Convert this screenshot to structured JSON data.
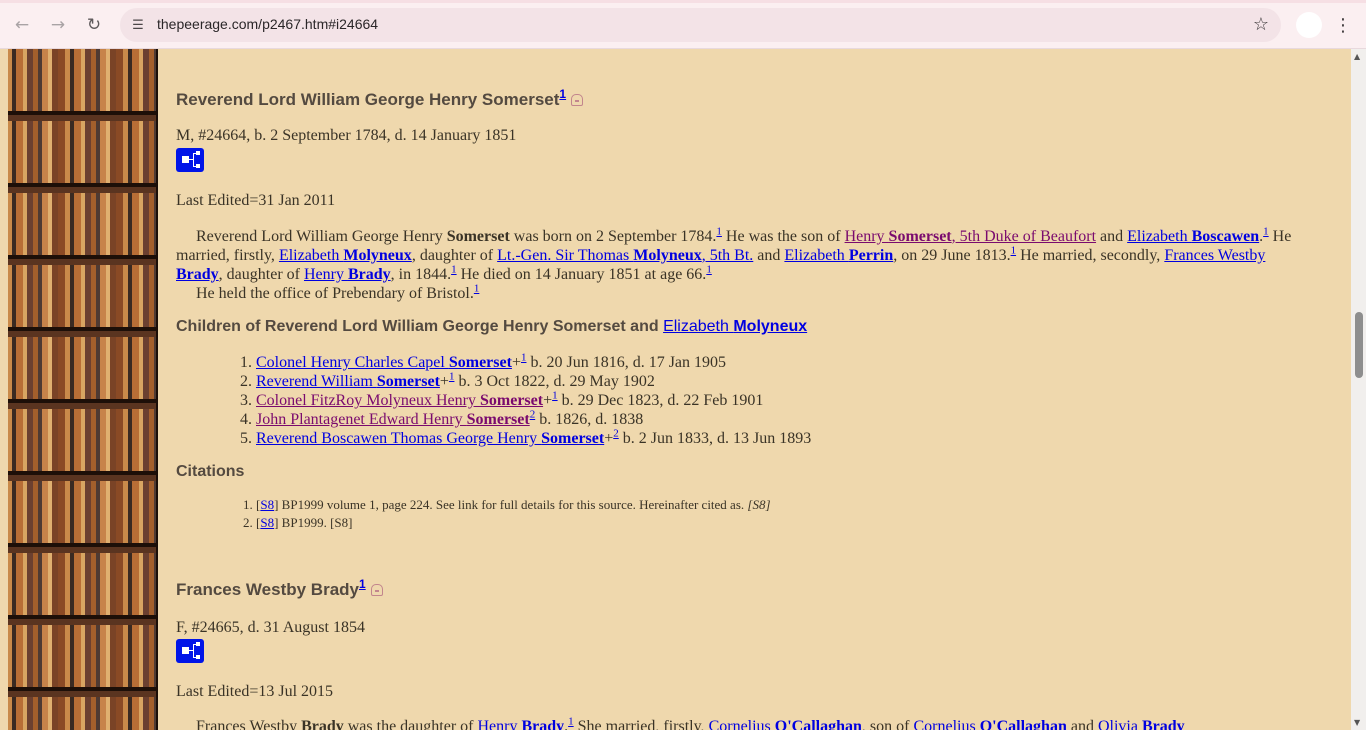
{
  "browser": {
    "url": "thepeerage.com/p2467.htm#i24664"
  },
  "person1": {
    "title_name": "Reverend Lord William George Henry Somerset",
    "title_sup": "1",
    "meta": "M, #24664, b. 2 September 1784, d. 14 January 1851",
    "last_edited": "Last Edited=31 Jan 2011",
    "bio": {
      "a": "Reverend Lord William George Henry ",
      "a_bold": "Somerset",
      "b": " was born on 2 September 1784.",
      "s1": "1",
      "c": " He was the son of ",
      "father_a": "Henry ",
      "father_bold": "Somerset",
      "father_b": ", 5th Duke of Beaufort",
      "d": " and ",
      "mother_a": "Elizabeth ",
      "mother_bold": "Boscawen",
      "e": ".",
      "s2": "1",
      "f": " He married, firstly, ",
      "wife1_a": "Elizabeth ",
      "wife1_bold": "Molyneux",
      "g": ", daughter of ",
      "wf1_a": "Lt.-Gen. Sir Thomas ",
      "wf1_bold": "Molyneux",
      "wf1_b": ", 5th Bt.",
      "h": " and ",
      "wm1_a": "Elizabeth ",
      "wm1_bold": "Perrin",
      "i": ", on 29 June 1813.",
      "s3": "1",
      "j": " He married, secondly, ",
      "wife2_a": "Frances Westby ",
      "wife2_bold": "Brady",
      "k": ", daughter of ",
      "wf2_a": "Henry ",
      "wf2_bold": "Brady",
      "l": ", in 1844.",
      "s4": "1",
      "m": " He died on 14 January 1851 at age 66.",
      "s5": "1",
      "office": "He held the office of Prebendary of Bristol.",
      "s6": "1"
    },
    "children_heading": "Children of Reverend Lord William George Henry Somerset and ",
    "children_heading_link_a": "Elizabeth ",
    "children_heading_link_bold": "Molyneux",
    "children": [
      {
        "name_a": "Colonel Henry Charles Capel ",
        "name_bold": "Somerset",
        "plus": "+",
        "sup": "1",
        "dates": " b. 20 Jun 1816, d. 17 Jan 1905",
        "visited": false
      },
      {
        "name_a": "Reverend William ",
        "name_bold": "Somerset",
        "plus": "+",
        "sup": "1",
        "dates": " b. 3 Oct 1822, d. 29 May 1902",
        "visited": false
      },
      {
        "name_a": "Colonel FitzRoy Molyneux Henry ",
        "name_bold": "Somerset",
        "plus": "+",
        "sup": "1",
        "dates": " b. 29 Dec 1823, d. 22 Feb 1901",
        "visited": true
      },
      {
        "name_a": "John Plantagenet Edward Henry ",
        "name_bold": "Somerset",
        "plus": "",
        "sup": "2",
        "dates": " b. 1826, d. 1838",
        "visited": true
      },
      {
        "name_a": "Reverend Boscawen Thomas George Henry ",
        "name_bold": "Somerset",
        "plus": "+",
        "sup": "2",
        "dates": " b. 2 Jun 1833, d. 13 Jun 1893",
        "visited": false
      }
    ],
    "citations_heading": "Citations",
    "citations": [
      {
        "ref": "S8",
        "text": " BP1999 volume 1, page 224. See link for full details for this source. Hereinafter cited as. ",
        "italic": "[S8]"
      },
      {
        "ref": "S8",
        "text": " BP1999. [S8]",
        "italic": ""
      }
    ]
  },
  "person2": {
    "title_name": "Frances Westby Brady",
    "title_sup": "1",
    "meta": "F, #24665, d. 31 August 1854",
    "last_edited": "Last Edited=13 Jul 2015",
    "bio": {
      "a": "Frances Westby ",
      "a_bold": "Brady",
      "b": " was the daughter of ",
      "father_a": "Henry ",
      "father_bold": "Brady",
      "c": ".",
      "s1": "1",
      "d": " She married, firstly, ",
      "h1_a": "Cornelius ",
      "h1_bold": "O'Callaghan",
      "e": ", son of ",
      "hf_a": "Cornelius ",
      "hf_bold": "O'Callaghan",
      "f": " and ",
      "hm_a": "Olivia ",
      "hm_bold": "Brady"
    }
  }
}
